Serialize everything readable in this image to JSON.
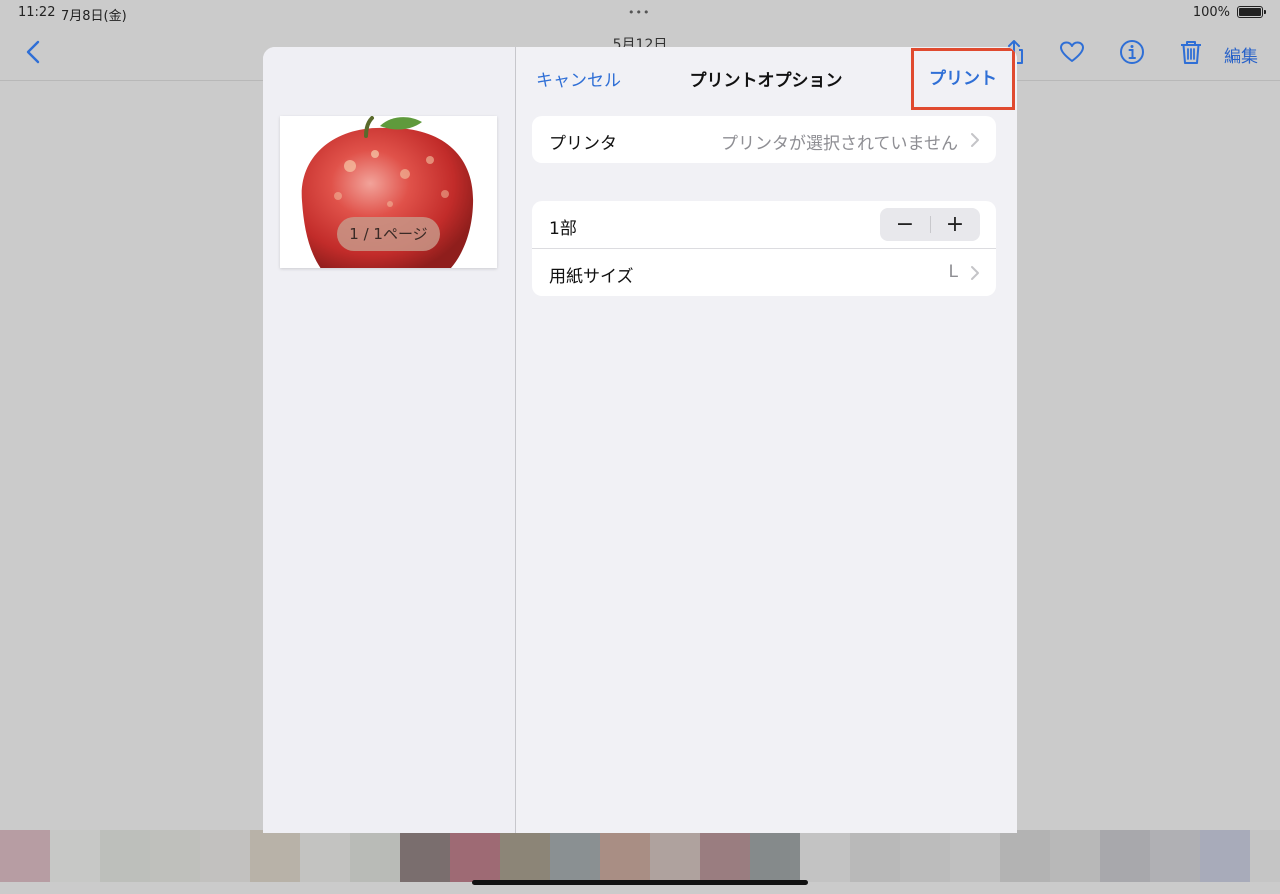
{
  "status_bar": {
    "time": "11:22",
    "date": "7月8日(金)",
    "dots": "•••",
    "battery_percent": "100%"
  },
  "photos_toolbar": {
    "title": "5月12日",
    "edit_label": "編集"
  },
  "print_sheet": {
    "cancel_label": "キャンセル",
    "title": "プリントオプション",
    "print_label": "プリント",
    "preview": {
      "page_badge": "1 / 1ページ"
    },
    "printer_row": {
      "label": "プリンタ",
      "value": "プリンタが選択されていません"
    },
    "copies_row": {
      "label": "1部",
      "minus": "−",
      "plus": "+"
    },
    "paper_row": {
      "label": "用紙サイズ",
      "value": "L"
    }
  },
  "colors": {
    "accent": "#2f6fd6",
    "highlight_box": "#e04a2f",
    "sheet_bg": "#f1f1f5"
  },
  "strip_colors": [
    "#b79da3",
    "#c7c8c6",
    "#bdbfbb",
    "#bfc0bc",
    "#c2c1bf",
    "#b8b2a8",
    "#c3c3c1",
    "#b9bbb7",
    "#7a6e6e",
    "#9e6a74",
    "#8c8577",
    "#8a9092",
    "#a98e84",
    "#afa29e",
    "#9a7d80",
    "#858a8b",
    "#c3c3c3",
    "#b9b9b9",
    "#bcbcbc",
    "#c0c0c0",
    "#b3b3b3",
    "#b8b8b8",
    "#a8a8ac",
    "#b0b0b4",
    "#a8abba",
    "#c5c5c5"
  ]
}
